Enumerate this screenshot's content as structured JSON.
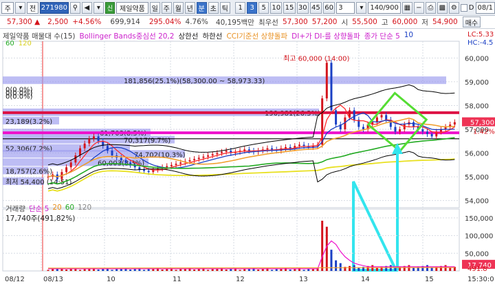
{
  "toolbar": {
    "combo_label": "주",
    "type_label": "전",
    "stock_code": "271980",
    "stock_badge": "신",
    "stock_name": "제일약품",
    "period_buttons": [
      "일",
      "주",
      "월",
      "년",
      "분",
      "초",
      "틱"
    ],
    "minute_buttons": [
      "1",
      "3",
      "5",
      "10",
      "15",
      "30",
      "45",
      "60"
    ],
    "interval_value": "3",
    "count_value": "140/900",
    "right_label": "D",
    "right_date": "08/1"
  },
  "quote": {
    "price": "57,300",
    "arrow": "▲",
    "change": "2,500",
    "change_pct": "+4.56%",
    "volume": "699,914",
    "turnover_pct": "295.04%",
    "ratio": "4.76%",
    "amount": "40,195백만",
    "best_label": "최우선",
    "best_ask": "57,300",
    "best_bid": "57,200",
    "open_label": "시",
    "open": "55,500",
    "high_label": "고",
    "high": "60,000",
    "low_label": "저",
    "low": "54,900",
    "buy_button": "매수"
  },
  "legend": {
    "stock": "제일약품 매물대 수(15)",
    "bollinger": "Bollinger Bands중심선 20,2",
    "upper": "상한선",
    "lower": "하한선",
    "cci": "CCI기준선 상향돌파",
    "dmi": "DI+가 DI-를 상향돌파",
    "close": "종가 단순 5",
    "close_n": "10",
    "lc": "LC:5.33",
    "hc": "HC:-4.5",
    "ma60": "60",
    "ma120": "120"
  },
  "colors": {
    "up": "#d4141c",
    "down": "#1a3fc4",
    "ma5": "#ff2a2a",
    "ma10": "#1a3fc4",
    "ma20": "#f0a030",
    "ma60": "#22aa22",
    "ma120": "#e8e020",
    "band": "#000000",
    "profile": "#9999ee",
    "magenta": "#ee11cc",
    "crimson": "#dd1144",
    "cyan": "#33e5ee",
    "lime": "#55dd33"
  },
  "price_axis": {
    "ticks": [
      "60,000",
      "59,000",
      "58,000",
      "57,000",
      "56,000",
      "55,000",
      "54,000"
    ],
    "current": "57,300",
    "current_pct": "1.42%"
  },
  "volume_axis": {
    "ticks": [
      "150,000",
      "100,000",
      "50,000"
    ],
    "current": "17,740",
    "bottom": "491.8"
  },
  "volume_legend": {
    "title": "거래량",
    "ma": "단순 5",
    "n20": "20",
    "n60": "60",
    "n120": "120",
    "value": "17,740주(491,82%)"
  },
  "time_axis": [
    "08/12",
    "08/13",
    "10",
    "11",
    "12",
    "13",
    "14",
    "15"
  ],
  "time_axis_right": "15:30:0",
  "annotations": {
    "high_mark": "최고 60,000 (14:00)",
    "low_mark": "최저 54,400 (14:51)",
    "range_label": "181,856(25.1%)(58,300.00 ~ 58,973.33)",
    "zero1": "0(0.0%)",
    "zero2": "0(0.0%)",
    "zero3": "0(0.0%)",
    "profile_a": "23,189(3.2%)",
    "profile_b": "61,703(8.5%)",
    "profile_c": "70,317(9.7%)",
    "profile_d": "52,306(7.2%)",
    "profile_e": "74,702(10.3%)",
    "profile_f": "60,003(8.3%)",
    "profile_g": "18,757(2.6%)",
    "profile_h": "190,981(26.3%)"
  }
}
